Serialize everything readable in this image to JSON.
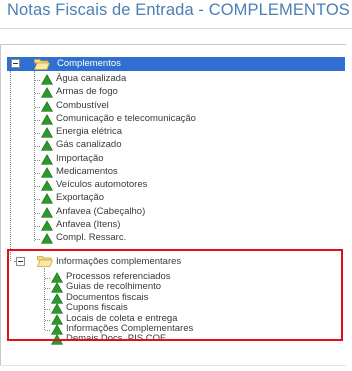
{
  "page_title": "Notas Fiscais de Entrada - COMPLEMENTOS",
  "tree": {
    "root_label": "Complementos",
    "root_items": [
      "Água canalizada",
      "Armas de fogo",
      "Combustível",
      "Comunicação e telecomunicação",
      "Energia elétrica",
      "Gás canalizado",
      "Importação",
      "Medicamentos",
      "Veículos automotores",
      "Exportação",
      "Anfavea (Cabeçalho)",
      "Anfavea (Itens)",
      "Compl. Ressarc."
    ],
    "section2_label": "Informações complementares",
    "section2_items": [
      "Processos referenciados",
      "Guias de recolhimento",
      "Documentos fiscais",
      "Cupons fiscais",
      "Locais de coleta e entrega",
      "Informações Complementares",
      "Demais Docs. PIS COF."
    ]
  },
  "colors": {
    "title": "#4a7fb5",
    "selection": "#2f6fcf",
    "leaf_icon": "#2a9a2a",
    "highlight": "#e0101a"
  },
  "icons": {
    "expander": "collapse-minus-icon",
    "folder": "folder-open-icon",
    "leaf": "green-triangle-icon"
  }
}
